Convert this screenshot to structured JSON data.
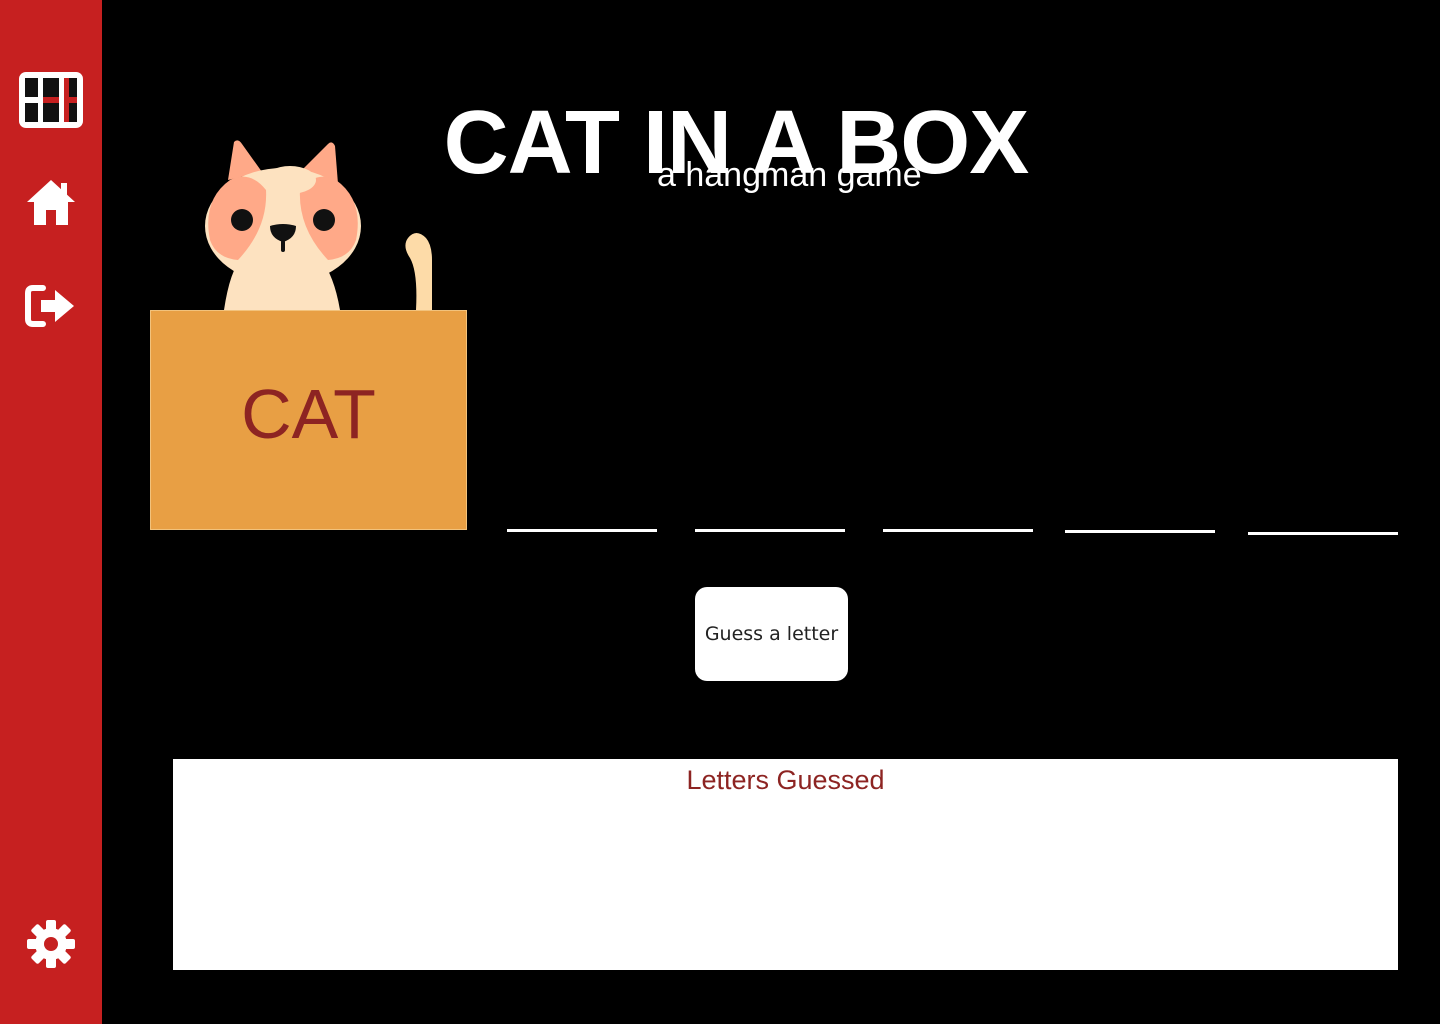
{
  "app": {
    "title": "CAT IN A BOX",
    "subtitle": "a hangman game"
  },
  "sidebar": {
    "background": "#c62020",
    "items": [
      {
        "name": "logo",
        "icon": "grid-logo-icon"
      },
      {
        "name": "home",
        "icon": "home-icon"
      },
      {
        "name": "logout",
        "icon": "sign-out-icon"
      },
      {
        "name": "settings",
        "icon": "gear-icon"
      }
    ]
  },
  "game": {
    "box_label": "CAT",
    "blanks": [
      "",
      "",
      "",
      "",
      ""
    ],
    "guess_button_label": "Guess a letter"
  },
  "letters_guessed": {
    "title": "Letters Guessed",
    "letters": ""
  },
  "colors": {
    "background": "#000000",
    "box": "#e89f44",
    "box_text": "#8d2422",
    "cat_ear": "#ffa988",
    "cat_face": "#fde2c0"
  }
}
